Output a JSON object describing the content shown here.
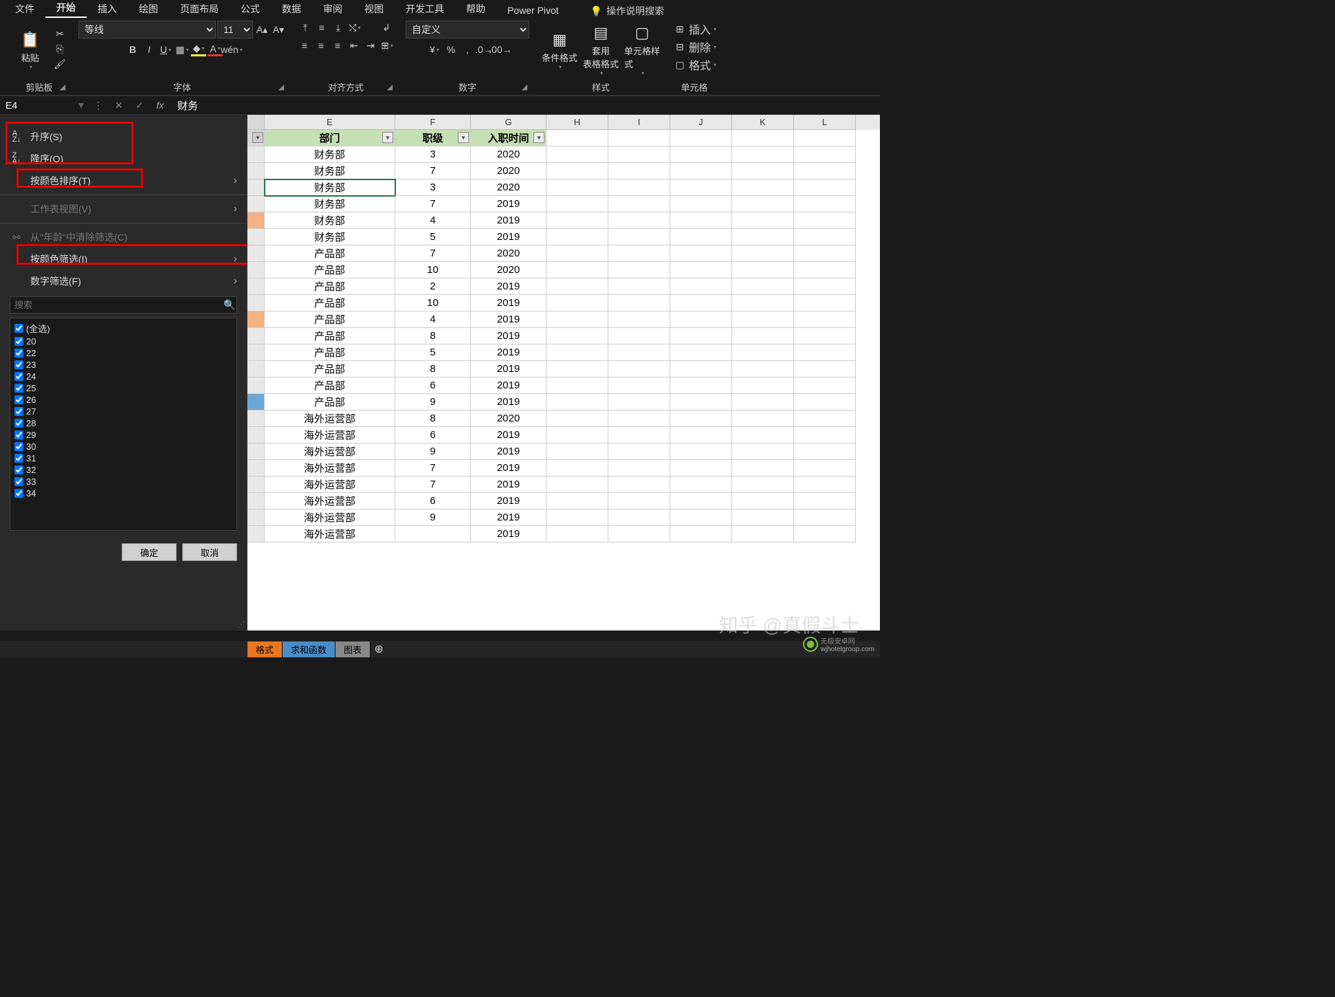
{
  "tabs": [
    "文件",
    "开始",
    "插入",
    "绘图",
    "页面布局",
    "公式",
    "数据",
    "审阅",
    "视图",
    "开发工具",
    "帮助",
    "Power Pivot"
  ],
  "active_tab": "开始",
  "search_hint": "操作说明搜索",
  "ribbon": {
    "paste": "粘贴",
    "clipboard": "剪贴板",
    "font_name": "等线",
    "font_size": "11",
    "font_group": "字体",
    "align_group": "对齐方式",
    "number_format": "自定义",
    "number_group": "数字",
    "cond_fmt": "条件格式",
    "table_fmt": "套用\n表格格式",
    "cell_styles": "单元格样式",
    "styles_group": "样式",
    "insert": "插入",
    "delete": "删除",
    "format": "格式",
    "cells_group": "单元格"
  },
  "formula_bar": {
    "name": "E4",
    "value": "财务"
  },
  "filter_menu": {
    "asc": "升序(S)",
    "desc": "降序(O)",
    "sort_color": "按颜色排序(T)",
    "sheet_view": "工作表视图(V)",
    "clear": "从\"年龄\"中清除筛选(C)",
    "filter_color": "按颜色筛选(I)",
    "number_filter": "数字筛选(F)",
    "search_ph": "搜索",
    "select_all": "(全选)",
    "values": [
      "20",
      "22",
      "23",
      "24",
      "25",
      "26",
      "27",
      "28",
      "29",
      "30",
      "31",
      "32",
      "33",
      "34"
    ],
    "ok": "确定",
    "cancel": "取消"
  },
  "cols": [
    "E",
    "F",
    "G",
    "H",
    "I",
    "J",
    "K",
    "L"
  ],
  "headers": {
    "e": "部门",
    "f": "职级",
    "g": "入职时间"
  },
  "rows": [
    {
      "e": "财务部",
      "f": "3",
      "g": "2020",
      "hl": ""
    },
    {
      "e": "财务部",
      "f": "7",
      "g": "2020",
      "hl": ""
    },
    {
      "e": "财务部",
      "f": "3",
      "g": "2020",
      "hl": "",
      "sel": true
    },
    {
      "e": "财务部",
      "f": "7",
      "g": "2019",
      "hl": ""
    },
    {
      "e": "财务部",
      "f": "4",
      "g": "2019",
      "hl": "orange"
    },
    {
      "e": "财务部",
      "f": "5",
      "g": "2019",
      "hl": ""
    },
    {
      "e": "产品部",
      "f": "7",
      "g": "2020",
      "hl": ""
    },
    {
      "e": "产品部",
      "f": "10",
      "g": "2020",
      "hl": ""
    },
    {
      "e": "产品部",
      "f": "2",
      "g": "2019",
      "hl": ""
    },
    {
      "e": "产品部",
      "f": "10",
      "g": "2019",
      "hl": ""
    },
    {
      "e": "产品部",
      "f": "4",
      "g": "2019",
      "hl": "orange"
    },
    {
      "e": "产品部",
      "f": "8",
      "g": "2019",
      "hl": ""
    },
    {
      "e": "产品部",
      "f": "5",
      "g": "2019",
      "hl": ""
    },
    {
      "e": "产品部",
      "f": "8",
      "g": "2019",
      "hl": ""
    },
    {
      "e": "产品部",
      "f": "6",
      "g": "2019",
      "hl": ""
    },
    {
      "e": "产品部",
      "f": "9",
      "g": "2019",
      "hl": "blue"
    },
    {
      "e": "海外运营部",
      "f": "8",
      "g": "2020",
      "hl": ""
    },
    {
      "e": "海外运营部",
      "f": "6",
      "g": "2019",
      "hl": ""
    },
    {
      "e": "海外运营部",
      "f": "9",
      "g": "2019",
      "hl": ""
    },
    {
      "e": "海外运营部",
      "f": "7",
      "g": "2019",
      "hl": ""
    },
    {
      "e": "海外运营部",
      "f": "7",
      "g": "2019",
      "hl": ""
    },
    {
      "e": "海外运营部",
      "f": "6",
      "g": "2019",
      "hl": ""
    },
    {
      "e": "海外运营部",
      "f": "9",
      "g": "2019",
      "hl": ""
    },
    {
      "e": "海外运营部",
      "f": "",
      "g": "2019",
      "hl": ""
    }
  ],
  "sheet_tabs": {
    "t1": "格式",
    "t2": "求和函数",
    "t3": "图表"
  },
  "watermark": "知乎 @真假斗士",
  "brand": "无极安卓网",
  "brand_url": "wjhotelgroup.com"
}
